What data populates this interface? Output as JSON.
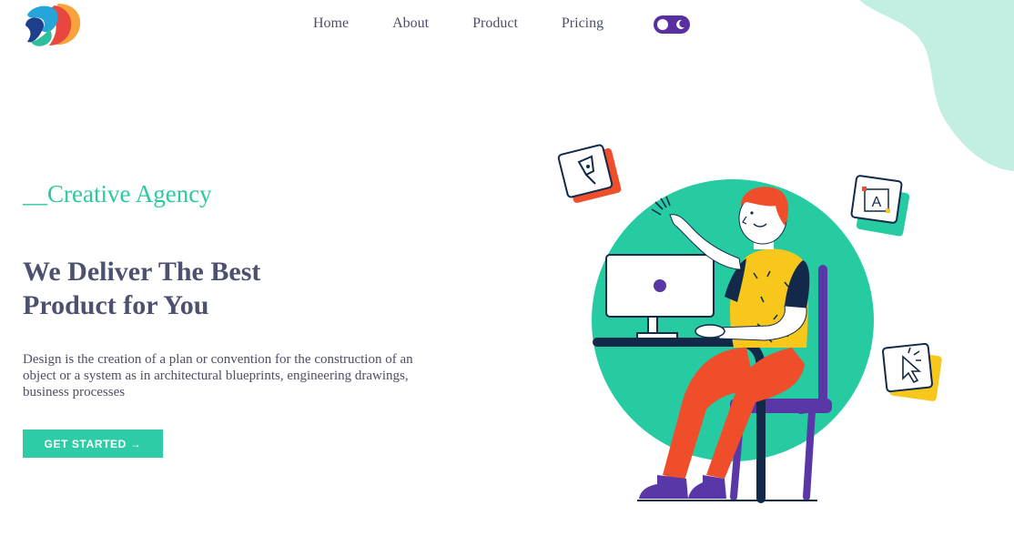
{
  "nav": {
    "items": [
      "Home",
      "About",
      "Product",
      "Pricing"
    ],
    "theme_toggle": "dark-mode-toggle"
  },
  "hero": {
    "eyebrow": "__Creative Agency",
    "headline_line1": "We Deliver The Best",
    "headline_line2": "Product for You",
    "description": "Design is the creation of a plan or convention for the construction of an object or a system as in architectural blueprints, engineering drawings, business processes",
    "cta_label": "GET STARTED →"
  },
  "illustration": {
    "badge_a_letter": "A"
  },
  "colors": {
    "accent": "#2dcca7",
    "heading": "#4c5170",
    "toggle": "#5a2fa0",
    "blob": "#c3efe3",
    "orange": "#f04e2b",
    "yellow": "#f7c81b",
    "navy": "#12294a",
    "purple": "#5a37a6"
  },
  "icons": [
    "logo-icon",
    "moon-icon",
    "pen-tool-icon",
    "text-tool-icon",
    "cursor-click-icon"
  ]
}
